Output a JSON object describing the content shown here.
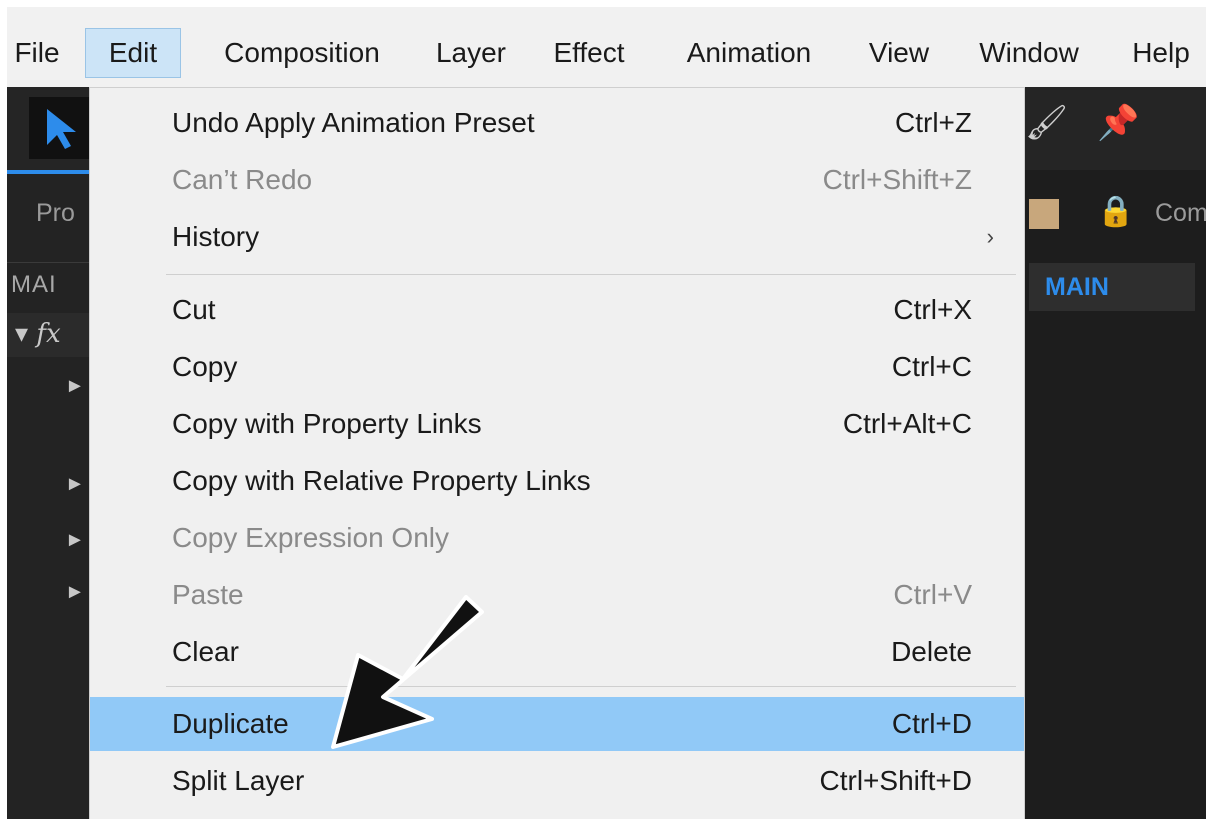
{
  "menubar": {
    "items": [
      {
        "label": "File"
      },
      {
        "label": "Edit"
      },
      {
        "label": "Composition"
      },
      {
        "label": "Layer"
      },
      {
        "label": "Effect"
      },
      {
        "label": "Animation"
      },
      {
        "label": "View"
      },
      {
        "label": "Window"
      },
      {
        "label": "Help"
      }
    ],
    "active": "Edit"
  },
  "background": {
    "project_tab": "Pro",
    "main_left": "MAI",
    "fx_row": "▾ fx",
    "comp_label": "Com",
    "main_right": "MAIN",
    "tools": {
      "selection": "selection-arrow-icon",
      "brush": "brush-icon",
      "pin": "puppet-pin-icon"
    }
  },
  "dropdown": {
    "items": [
      {
        "label": "Undo Apply Animation Preset",
        "shortcut": "Ctrl+Z"
      },
      {
        "label": "Can’t Redo",
        "shortcut": "Ctrl+Shift+Z"
      },
      {
        "label": "History",
        "shortcut": "›"
      },
      {
        "label": "Cut",
        "shortcut": "Ctrl+X"
      },
      {
        "label": "Copy",
        "shortcut": "Ctrl+C"
      },
      {
        "label": "Copy with Property Links",
        "shortcut": "Ctrl+Alt+C"
      },
      {
        "label": "Copy with Relative Property Links",
        "shortcut": ""
      },
      {
        "label": "Copy Expression Only",
        "shortcut": ""
      },
      {
        "label": "Paste",
        "shortcut": "Ctrl+V"
      },
      {
        "label": "Clear",
        "shortcut": "Delete"
      },
      {
        "label": "Duplicate",
        "shortcut": "Ctrl+D"
      },
      {
        "label": "Split Layer",
        "shortcut": "Ctrl+Shift+D"
      }
    ],
    "highlighted": "Duplicate",
    "disabled": [
      "Can’t Redo",
      "Copy Expression Only",
      "Paste"
    ]
  },
  "colors": {
    "menu_highlight": "#91c9f7",
    "menubar_active": "#cce4f7",
    "panel_bg": "#232323",
    "accent_blue": "#2d8ceb",
    "annotation_arrow": "#111111"
  }
}
